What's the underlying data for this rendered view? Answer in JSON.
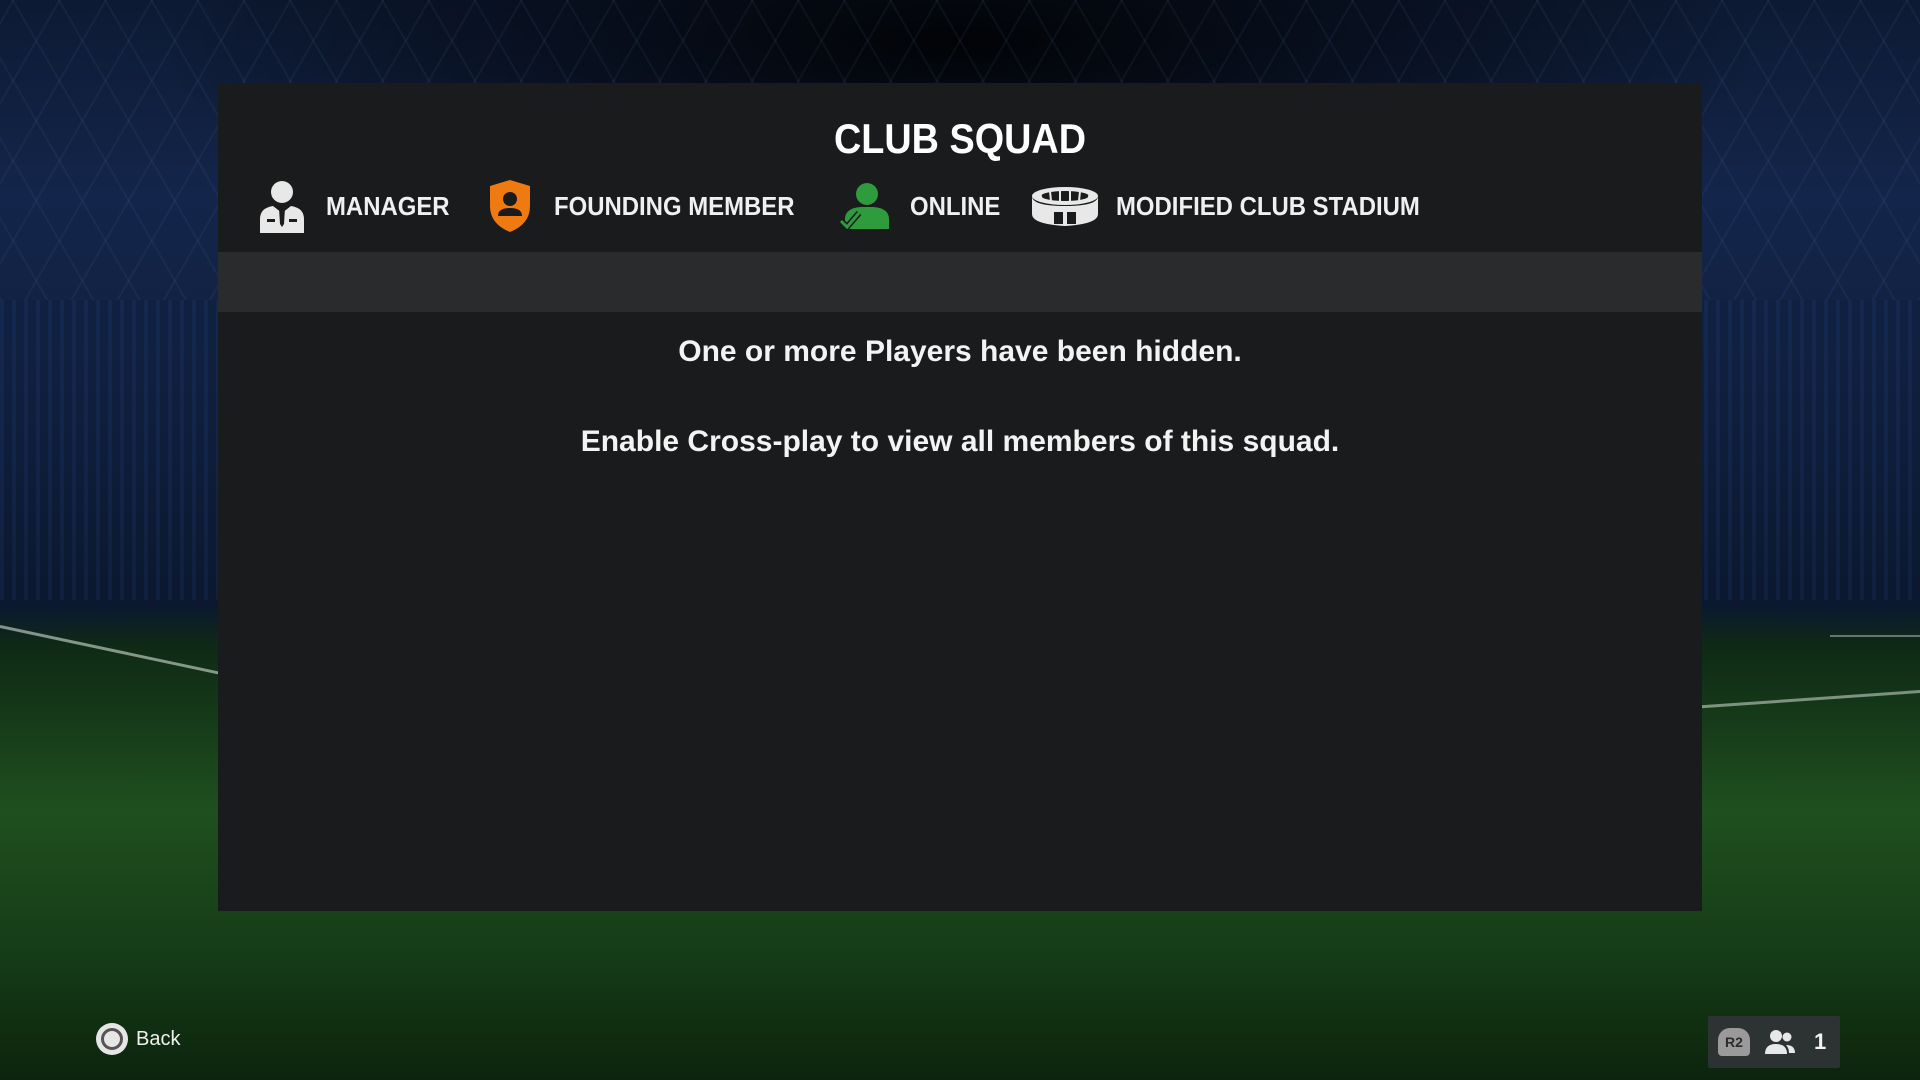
{
  "screen": {
    "title": "CLUB SQUAD"
  },
  "legend": {
    "items": [
      {
        "label": "MANAGER",
        "icon": "manager-icon"
      },
      {
        "label": "FOUNDING MEMBER",
        "icon": "founding-member-shield-icon",
        "color": "#f07a12"
      },
      {
        "label": "ONLINE",
        "icon": "online-player-icon",
        "color": "#2e9b3c"
      },
      {
        "label": "MODIFIED CLUB STADIUM",
        "icon": "stadium-icon"
      }
    ]
  },
  "messages": {
    "hidden_players": "One or more Players have been hidden.",
    "crossplay_hint": "Enable Cross-play to view all members of this squad."
  },
  "footer": {
    "back_label": "Back",
    "back_button_icon": "circle-button-icon",
    "r2_label": "R2",
    "friends_count": "1"
  }
}
